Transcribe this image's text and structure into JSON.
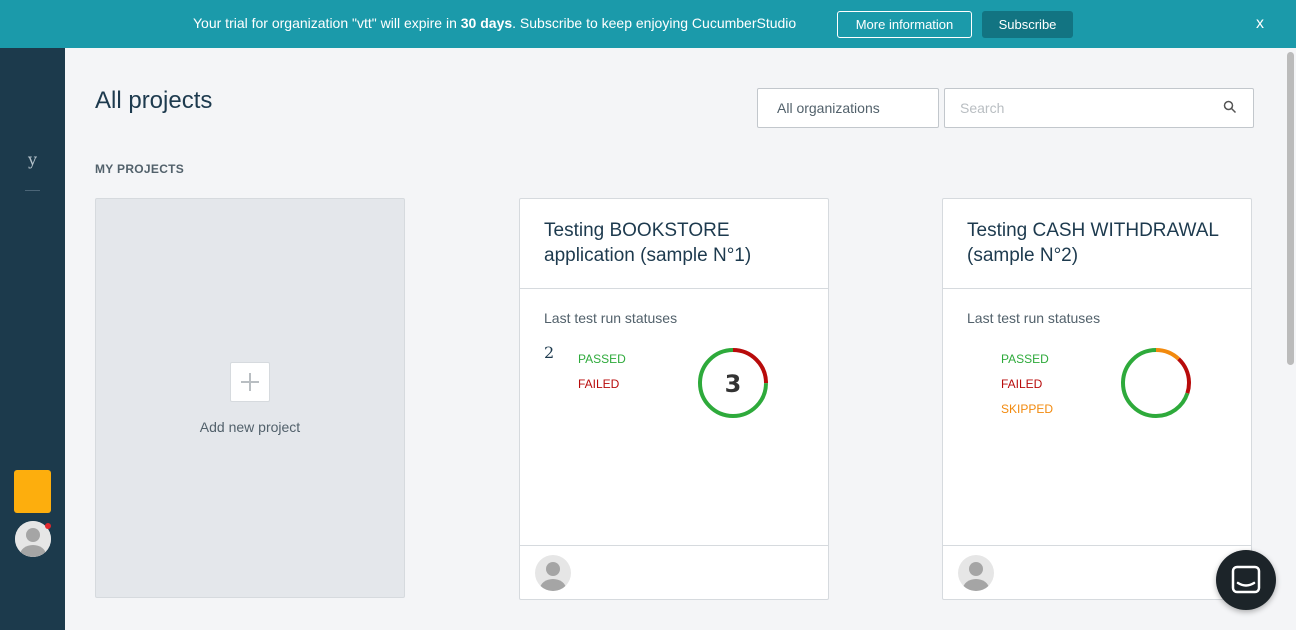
{
  "banner": {
    "text_before": "Your trial for organization \"vtt\" will expire in ",
    "days": "30 days",
    "text_after": ". Subscribe to keep enjoying CucumberStudio",
    "more_info_label": "More information",
    "subscribe_label": "Subscribe",
    "close_label": "x",
    "color": "#1b9aaa"
  },
  "sidebar": {
    "letter": "y",
    "color": "#1c3a4c",
    "accent": "#fdae0d"
  },
  "header": {
    "title": "All projects",
    "org_filter": "All organizations",
    "search_placeholder": "Search"
  },
  "section": {
    "label": "MY PROJECTS"
  },
  "add_project": {
    "label": "Add new project"
  },
  "projects": [
    {
      "title": "Testing BOOKSTORE application (sample N°1)",
      "statuses_label": "Last test run statuses",
      "count": "2",
      "legend": [
        "PASSED",
        "FAILED"
      ],
      "donut_label": "3",
      "donut": {
        "passed": 0.75,
        "failed": 0.25,
        "skipped": 0
      }
    },
    {
      "title": "Testing CASH WITHDRAWAL (sample N°2)",
      "statuses_label": "Last test run statuses",
      "count": "",
      "legend": [
        "PASSED",
        "FAILED",
        "SKIPPED"
      ],
      "donut_label": "",
      "donut": {
        "passed": 0.7,
        "failed": 0.18,
        "skipped": 0.12
      }
    }
  ],
  "colors": {
    "passed": "#2eaa3b",
    "failed": "#b80b0b",
    "skipped": "#f28a0e"
  }
}
